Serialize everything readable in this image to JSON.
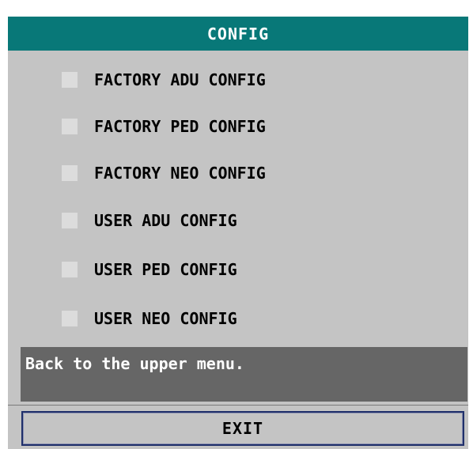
{
  "dialog": {
    "title": "CONFIG",
    "items": [
      {
        "label": "FACTORY ADU CONFIG"
      },
      {
        "label": "FACTORY PED CONFIG"
      },
      {
        "label": "FACTORY NEO CONFIG"
      },
      {
        "label": "USER ADU CONFIG"
      },
      {
        "label": "USER PED CONFIG"
      },
      {
        "label": "USER NEO CONFIG"
      }
    ],
    "help_text": "Back to the upper menu.",
    "exit_label": "EXIT"
  },
  "colors": {
    "title_bar": "#087878",
    "panel_background": "#c4c4c4",
    "help_background": "#666666",
    "item_box": "#dcdcdc"
  }
}
